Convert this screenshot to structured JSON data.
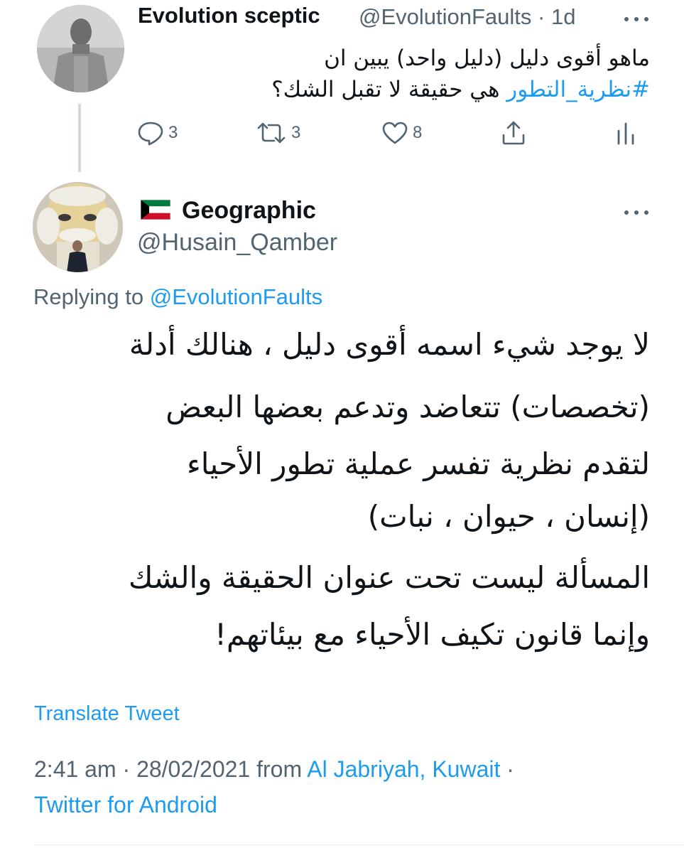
{
  "parent_tweet": {
    "display_name": "Evolution sceptic",
    "handle_time": "@EvolutionFaults · 1d",
    "text_line1": "ماهو أقوى دليل (دليل واحد) يبين ان",
    "text_line2_plain": "هي حقيقة لا تقبل الشك؟",
    "hashtag": "#نظرية_التطور",
    "replies": "3",
    "retweets": "3",
    "likes": "8"
  },
  "reply_tweet": {
    "display_name": "Geographic",
    "handle": "@Husain_Qamber",
    "replying_label": "Replying to",
    "replying_to": "@EvolutionFaults",
    "lines": [
      "لا يوجد شيء اسمه أقوى دليل ، هنالك أدلة",
      "(تخصصات) تتعاضد وتدعم بعضها البعض",
      "لتقدم نظرية تفسر عملية تطور الأحياء",
      "(إنسان ، حيوان ، نبات)",
      "المسألة ليست تحت عنوان الحقيقة والشك",
      "وإنما قانون تكيف الأحياء مع بيئاتهم!"
    ],
    "translate_label": "Translate Tweet",
    "timestamp": "2:41 am · 28/02/2021",
    "from_label": "from",
    "location": "Al Jabriyah, Kuwait",
    "separator": "·",
    "source": "Twitter for Android"
  },
  "colors": {
    "accent": "#1d9bf0",
    "secondary_text": "#536471",
    "primary_text": "#0f1419",
    "thread_line": "#cfd9de"
  }
}
